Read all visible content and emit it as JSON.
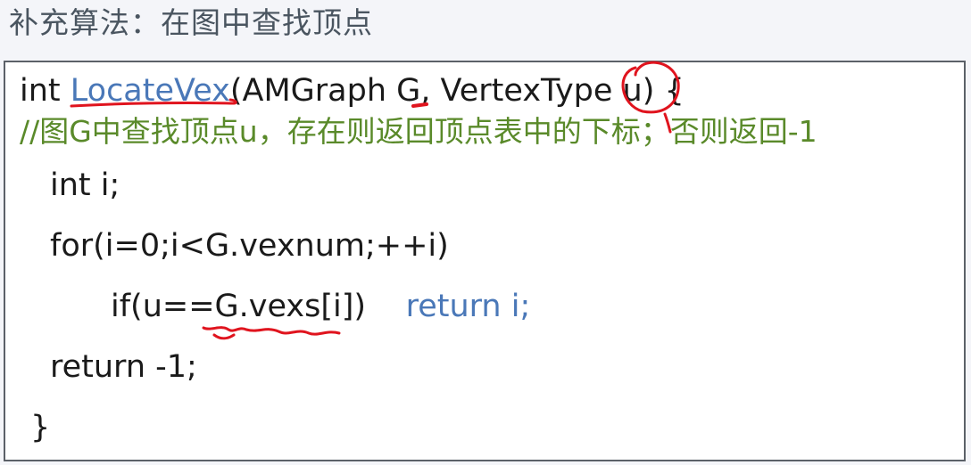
{
  "title": "补充算法：在图中查找顶点",
  "code": {
    "line1": {
      "kw": "int ",
      "fn": "LocateVex",
      "rest": "(AMGraph G, VertexType u) {"
    },
    "comment": "//图G中查找顶点u，存在则返回顶点表中的下标；否则返回-1",
    "line3": "int i;",
    "line4": "for(i=0;i<G.vexnum;++i)",
    "line5": {
      "cond": "if(u==G.vexs[i])",
      "ret": "return i;"
    },
    "line6": "return -1;",
    "line7": "}"
  },
  "colors": {
    "annotation": "#e0141e",
    "comment": "#5a8a2a",
    "function": "#4a78b8"
  }
}
